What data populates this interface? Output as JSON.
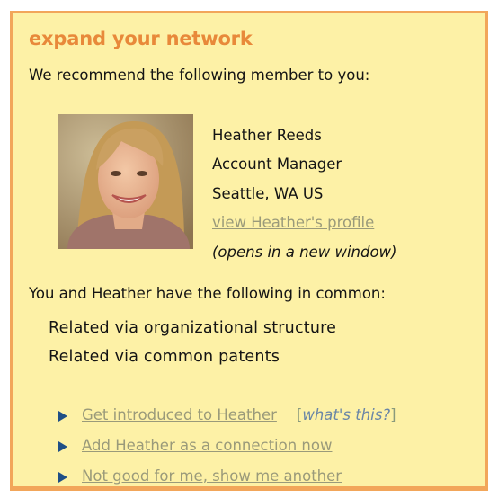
{
  "widget": {
    "heading": "expand your network",
    "intro": "We recommend the following member to you:"
  },
  "member": {
    "name": "Heather Reeds",
    "title": "Account Manager",
    "location": "Seattle, WA US",
    "profile_link": "view Heather's profile",
    "profile_note": "(opens in a new window)"
  },
  "common": {
    "title": "You and Heather have the following in common:",
    "items": [
      "Related via organizational structure",
      "Related via common patents"
    ]
  },
  "actions": {
    "items": [
      "Get introduced to Heather",
      "Add Heather as a connection now",
      "Not good for me, show me another"
    ],
    "whats_this_open": "[",
    "whats_this": "what's this?",
    "whats_this_close": "]"
  },
  "colors": {
    "panel_background": "#fdf1a6",
    "panel_border": "#f2a65a",
    "heading": "#e8893a",
    "link": "#9a9a7a",
    "arrow": "#1f4f86"
  },
  "icons": {
    "bullet": "triangle-right-icon"
  }
}
